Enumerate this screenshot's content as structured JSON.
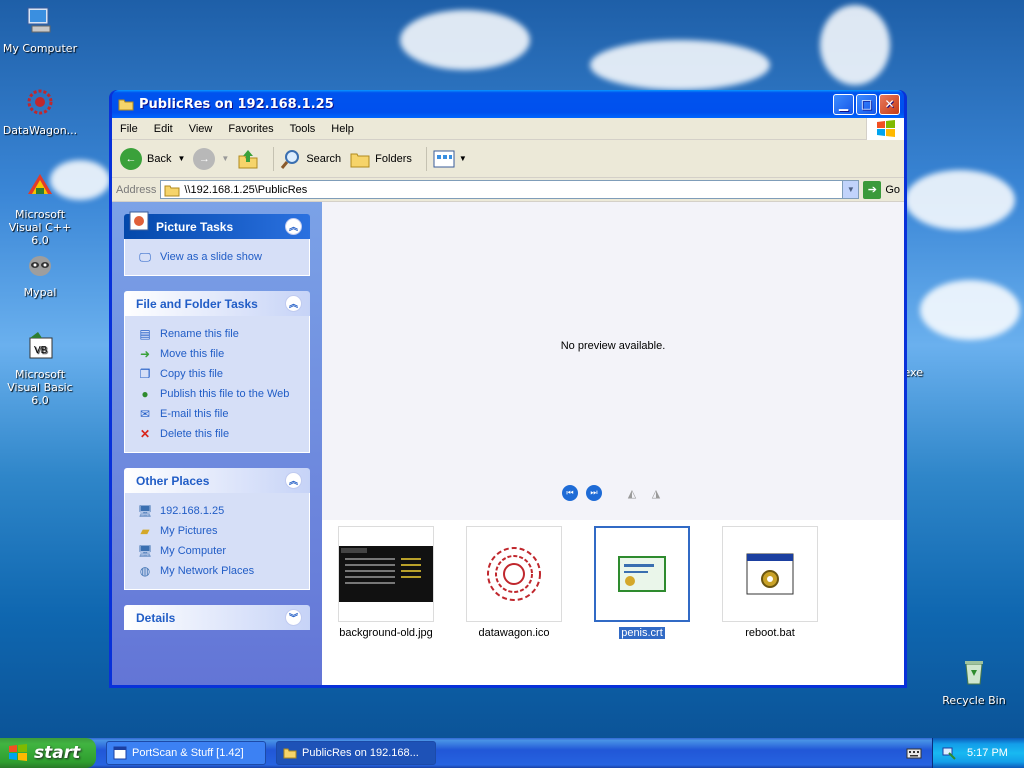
{
  "desktop": {
    "icons": [
      {
        "label": "My Computer"
      },
      {
        "label": "DataWagon..."
      },
      {
        "label": "Microsoft Visual C++ 6.0"
      },
      {
        "label": "Mypal"
      },
      {
        "label": "Microsoft Visual Basic 6.0"
      },
      {
        "label": "Recycle Bin"
      }
    ],
    "partial_label": ".exe"
  },
  "window": {
    "title": "PublicRes on 192.168.1.25",
    "menu": [
      "File",
      "Edit",
      "View",
      "Favorites",
      "Tools",
      "Help"
    ],
    "toolbar": {
      "back": "Back",
      "search": "Search",
      "folders": "Folders"
    },
    "address": {
      "label": "Address",
      "value": "\\\\192.168.1.25\\PublicRes",
      "go": "Go"
    },
    "taskpane": {
      "picture_tasks": {
        "title": "Picture Tasks",
        "items": [
          "View as a slide show"
        ]
      },
      "file_tasks": {
        "title": "File and Folder Tasks",
        "items": [
          "Rename this file",
          "Move this file",
          "Copy this file",
          "Publish this file to the Web",
          "E-mail this file",
          "Delete this file"
        ]
      },
      "other_places": {
        "title": "Other Places",
        "items": [
          "192.168.1.25",
          "My Pictures",
          "My Computer",
          "My Network Places"
        ]
      },
      "details": {
        "title": "Details"
      }
    },
    "preview": {
      "message": "No preview available."
    },
    "files": [
      {
        "name": "background-old.jpg",
        "selected": false
      },
      {
        "name": "datawagon.ico",
        "selected": false
      },
      {
        "name": "penis.crt",
        "selected": true
      },
      {
        "name": "reboot.bat",
        "selected": false
      }
    ]
  },
  "taskbar": {
    "start": "start",
    "tasks": [
      "PortScan & Stuff [1.42]",
      "PublicRes on 192.168..."
    ],
    "clock": "5:17 PM"
  },
  "colors": {
    "xp_blue": "#0053ee",
    "taskpane_link": "#215dc6",
    "selection": "#316ac5",
    "start_green": "#41b441"
  }
}
